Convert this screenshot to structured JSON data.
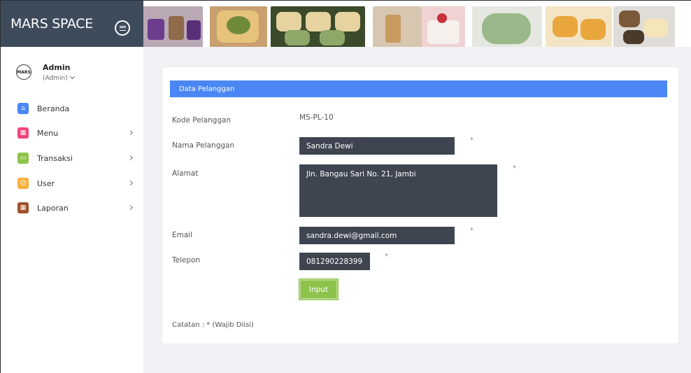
{
  "app": {
    "brand": "MARS SPACE",
    "toggle_icon": "hamburger-icon"
  },
  "sidebar": {
    "user": {
      "avatar_text": "MARS",
      "name": "Admin",
      "role": "(Admin)"
    },
    "items": [
      {
        "label": "Beranda",
        "icon": "home-icon",
        "color": "#4a87f5",
        "glyph": "⌂",
        "has_arrow": false
      },
      {
        "label": "Menu",
        "icon": "grid-icon",
        "color": "#f0467a",
        "glyph": "▦",
        "has_arrow": true
      },
      {
        "label": "Transaksi",
        "icon": "chat-icon",
        "color": "#8dc34a",
        "glyph": "▭",
        "has_arrow": true
      },
      {
        "label": "User",
        "icon": "user-icon",
        "color": "#f6b13c",
        "glyph": "☺",
        "has_arrow": true
      },
      {
        "label": "Laporan",
        "icon": "grid-icon",
        "color": "#a0522d",
        "glyph": "▦",
        "has_arrow": true
      }
    ]
  },
  "form": {
    "header": "Data Pelanggan",
    "code_label": "Kode Pelanggan",
    "code_value": "MS-PL-10",
    "name_label": "Nama Pelanggan",
    "name_value": "Sandra Dewi",
    "address_label": "Alamat",
    "address_value": "Jln. Bangau Sari No. 21, Jambi",
    "email_label": "Email",
    "email_value": "sandra.dewi@gmail.com",
    "phone_label": "Telepon",
    "phone_value": "081290228399",
    "required_mark": "*",
    "submit_label": "Input",
    "note": "Catatan : * (Wajib Diisi)"
  },
  "colors": {
    "topbar": "#3e4b5b",
    "header_blue": "#4a87f5",
    "field_dark": "#3f4550",
    "button_green": "#8dc34a",
    "main_bg": "#f2f2f6"
  }
}
